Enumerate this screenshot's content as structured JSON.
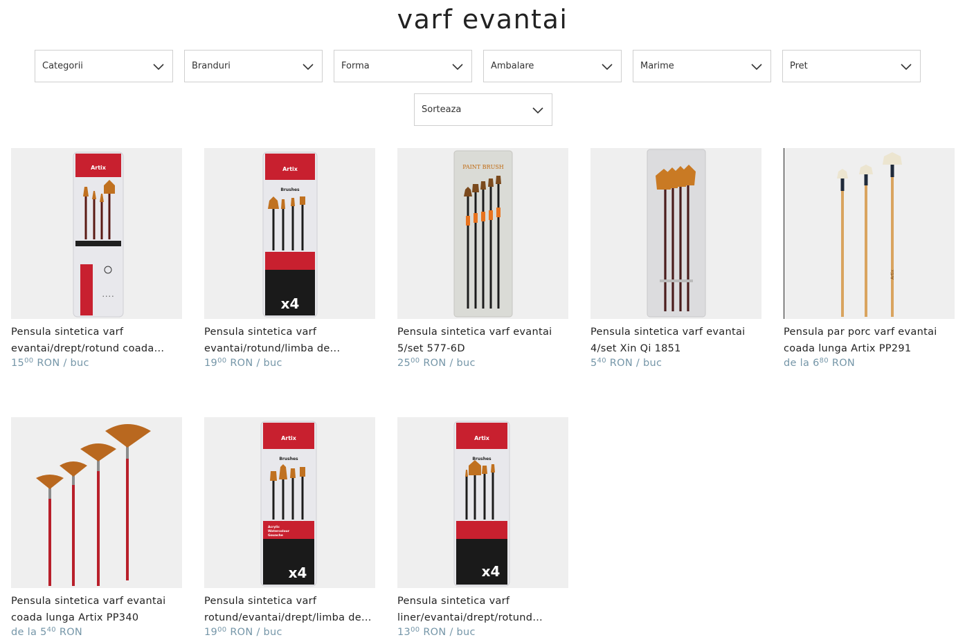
{
  "page": {
    "title": "varf evantai"
  },
  "filters": [
    {
      "label": "Categorii"
    },
    {
      "label": "Branduri"
    },
    {
      "label": "Forma"
    },
    {
      "label": "Ambalare"
    },
    {
      "label": "Marime"
    },
    {
      "label": "Pret"
    }
  ],
  "sort": {
    "label": "Sorteaza"
  },
  "products": [
    {
      "name": "Pensula sintetica varf evantai/drept/rotund coada...",
      "prefix": "",
      "int": "15",
      "dec": "00",
      "suffix": "RON / buc"
    },
    {
      "name": "Pensula sintetica varf evantai/rotund/limba de...",
      "prefix": "",
      "int": "19",
      "dec": "00",
      "suffix": "RON / buc"
    },
    {
      "name": "Pensula sintetica varf evantai 5/set 577-6D",
      "prefix": "",
      "int": "25",
      "dec": "00",
      "suffix": "RON / buc"
    },
    {
      "name": "Pensula sintetica varf evantai 4/set Xin Qi 1851",
      "prefix": "",
      "int": "5",
      "dec": "40",
      "suffix": "RON / buc"
    },
    {
      "name": "Pensula par porc varf evantai coada lunga Artix PP291",
      "prefix": "de la ",
      "int": "6",
      "dec": "80",
      "suffix": "RON"
    },
    {
      "name": "Pensula sintetica varf evantai coada lunga Artix PP340",
      "prefix": "de la ",
      "int": "5",
      "dec": "40",
      "suffix": "RON"
    },
    {
      "name": "Pensula sintetica varf rotund/evantai/drept/limba de...",
      "prefix": "",
      "int": "19",
      "dec": "00",
      "suffix": "RON / buc"
    },
    {
      "name": "Pensula sintetica varf liner/evantai/drept/rotund coada...",
      "prefix": "",
      "int": "13",
      "dec": "00",
      "suffix": "RON / buc"
    }
  ],
  "package_text": {
    "artix_brand": "Artix",
    "brushes": "Brushes",
    "acrylic_line": "Acrylic",
    "watercolour_line": "Watercolour",
    "gouache_line": "Gouache",
    "count": "x4",
    "paint_brush": "PAINT BRUSH",
    "pp_marking": "Artix"
  },
  "colors": {
    "price": "#7596a8",
    "thumb_bg": "#efefef",
    "artix_red": "#c8202f",
    "brush_black": "#1c1c1c",
    "brush_orange": "#d27a26",
    "wood_handle": "#d9a45f",
    "red_handle": "#b81f2a"
  }
}
